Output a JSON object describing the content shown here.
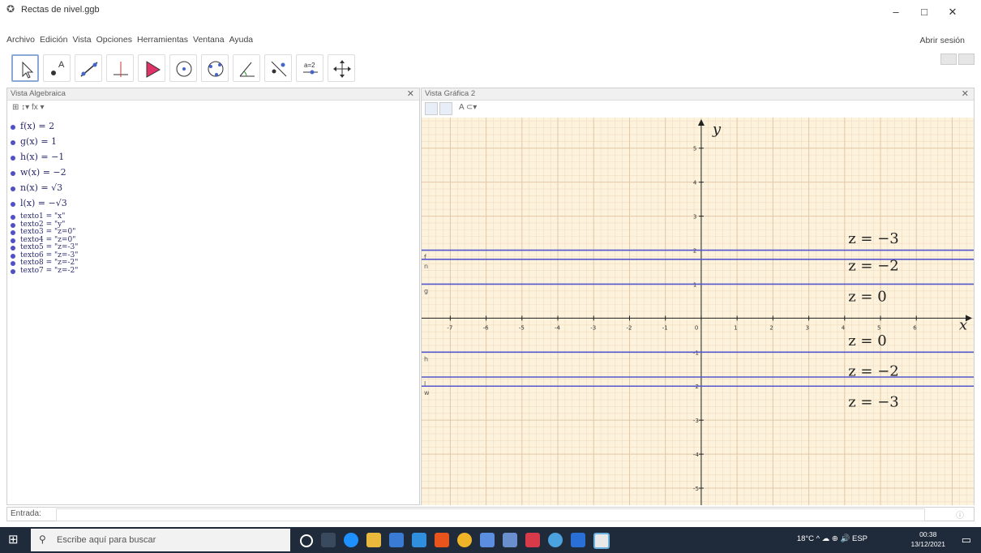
{
  "window": {
    "title": "Rectas de nivel.ggb",
    "minimize": "–",
    "maximize": "□",
    "close": "✕"
  },
  "menu": {
    "items": [
      "Archivo",
      "Edición",
      "Vista",
      "Opciones",
      "Herramientas",
      "Ventana",
      "Ayuda"
    ],
    "signin": "Abrir sesión"
  },
  "toolbar": {
    "tools": [
      "move-tool-icon",
      "point-tool-icon",
      "line-tool-icon",
      "perpendicular-tool-icon",
      "polygon-tool-icon",
      "circle-tool-icon",
      "conic-tool-icon",
      "angle-tool-icon",
      "reflect-tool-icon",
      "slider-tool-icon",
      "move-view-tool-icon"
    ]
  },
  "algebra": {
    "header": "Vista Algebraica",
    "tools_text": "⊞  ↕▾  fx ▾",
    "items": [
      {
        "text": "f(x) = 2",
        "small": false
      },
      {
        "text": "g(x) = 1",
        "small": false
      },
      {
        "text": "h(x) = −1",
        "small": false
      },
      {
        "text": "w(x) = −2",
        "small": false
      },
      {
        "text": "n(x) = √3",
        "small": false
      },
      {
        "text": "l(x) = −√3",
        "small": false
      },
      {
        "text": "texto1 = \"x\"",
        "small": true
      },
      {
        "text": "texto2 = \"y\"",
        "small": true
      },
      {
        "text": "texto3 = \"z=0\"",
        "small": true
      },
      {
        "text": "texto4 = \"z=0\"",
        "small": true
      },
      {
        "text": "texto5 = \"z=-3\"",
        "small": true
      },
      {
        "text": "texto6 = \"z=-3\"",
        "small": true
      },
      {
        "text": "texto8 = \"z=-2\"",
        "small": true
      },
      {
        "text": "texto7 = \"z=-2\"",
        "small": true
      }
    ]
  },
  "graphics": {
    "header": "Vista Gráfica 2",
    "tools_text": "A  ⊂▾",
    "x_label": "x",
    "y_label": "y",
    "x_ticks": [
      "-7",
      "-6",
      "-5",
      "-4",
      "-3",
      "-2",
      "-1",
      "0",
      "1",
      "2",
      "3",
      "4",
      "5",
      "6"
    ],
    "y_ticks": [
      "5",
      "4",
      "3",
      "2",
      "1",
      "-1",
      "-2",
      "-3",
      "-4",
      "-5"
    ],
    "xlim": [
      -7.8,
      7.6
    ],
    "ylim": [
      -5.5,
      5.9
    ],
    "lines": [
      {
        "name": "f",
        "y": 2
      },
      {
        "name": "n",
        "y": 1.732
      },
      {
        "name": "g",
        "y": 1
      },
      {
        "name": "h",
        "y": -1
      },
      {
        "name": "l",
        "y": -1.732
      },
      {
        "name": "w",
        "y": -2
      }
    ],
    "line_color": "#5555cc",
    "texts": [
      {
        "text": "z = −3",
        "x": 4.1,
        "y": 2.2
      },
      {
        "text": "z = −2",
        "x": 4.1,
        "y": 1.4
      },
      {
        "text": "z = 0",
        "x": 4.1,
        "y": 0.5
      },
      {
        "text": "z = 0",
        "x": 4.1,
        "y": -0.8
      },
      {
        "text": "z = −2",
        "x": 4.1,
        "y": -1.7
      },
      {
        "text": "z = −3",
        "x": 4.1,
        "y": -2.6
      }
    ]
  },
  "input": {
    "label": "Entrada:"
  },
  "taskbar": {
    "search_placeholder": "Escribe aquí para buscar",
    "tray": "18°C  ^  ☁  ⊕  🔊  ESP",
    "time": "00:38",
    "date": "13/12/2021"
  }
}
